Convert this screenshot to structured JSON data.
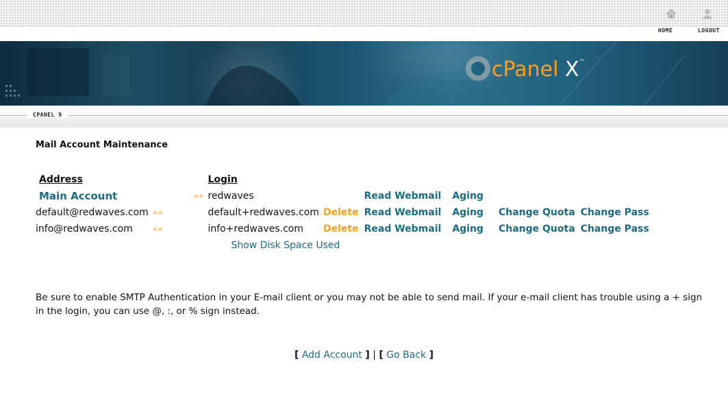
{
  "header": {
    "nav": {
      "home": "HOME",
      "logout": "LOGOUT"
    },
    "logo": {
      "brand": "cPanel",
      "suffix": "X",
      "tm": "™"
    },
    "section_label": "CPANEL 9"
  },
  "main": {
    "title": "Mail Account Maintenance",
    "columns": {
      "address": "Address",
      "login": "Login"
    },
    "separator": "»»",
    "rows": [
      {
        "address": "Main Account",
        "login": "redwaves",
        "delete": "",
        "read": "Read Webmail",
        "aging": "Aging",
        "quota": "",
        "pass": ""
      },
      {
        "address": "default@redwaves.com",
        "login": "default+redwaves.com",
        "delete": "Delete",
        "read": "Read Webmail",
        "aging": "Aging",
        "quota": "Change Quota",
        "pass": "Change Pass"
      },
      {
        "address": "info@redwaves.com",
        "login": "info+redwaves.com",
        "delete": "Delete",
        "read": "Read Webmail",
        "aging": "Aging",
        "quota": "Change Quota",
        "pass": "Change Pass"
      }
    ],
    "show_disk": "Show Disk Space Used",
    "note": "Be sure to enable SMTP Authentication in your E-mail client or you may not be able to send mail. If your e-mail client has trouble using a + sign in the login, you can use @, :, or % sign instead.",
    "bottom": {
      "open": "[",
      "close": "]",
      "pipe": "|",
      "add": "Add Account",
      "back": "Go Back"
    }
  },
  "colors": {
    "link": "#1a6a80",
    "accent": "#ff9e1b",
    "banner": "#1e4d63"
  }
}
